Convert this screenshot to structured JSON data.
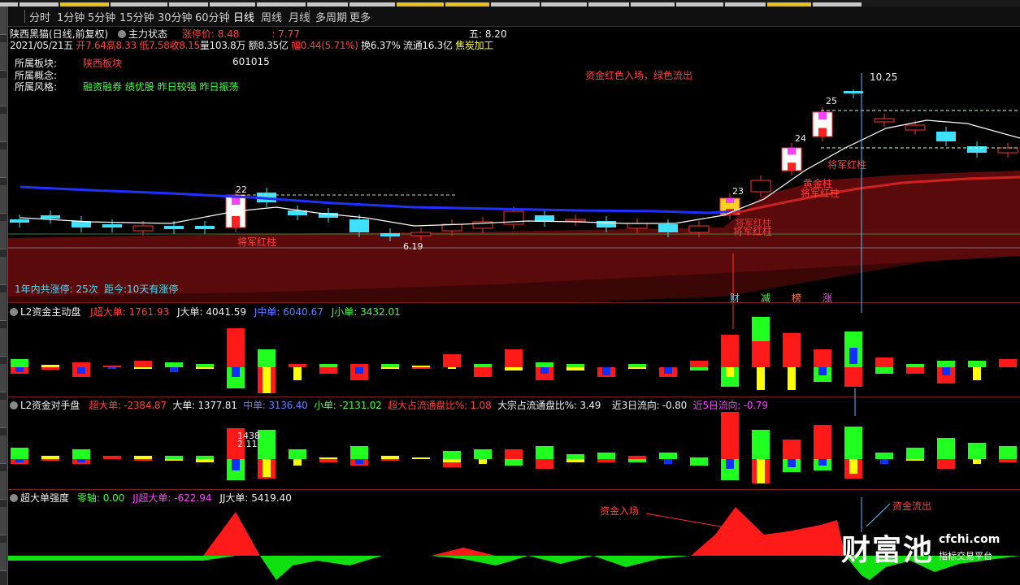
{
  "period_bar": {
    "items": [
      "分时",
      "1分钟",
      "5分钟",
      "15分钟",
      "30分钟",
      "60分钟",
      "日线",
      "周线",
      "月线",
      "多周期",
      "更多"
    ],
    "active": "日线"
  },
  "main": {
    "title": "陕西黑猫(日线,前复权)",
    "indicator": "主力状态",
    "limit_label": "涨停价: 8.48",
    "limit_extra": ": 7.77",
    "five_label": "五: 8.20",
    "date": "2021/05/21五",
    "open": "开7.64",
    "high": "高8.33",
    "low": "低7.58",
    "close": "收8.15",
    "volume": "量103.8万",
    "amount": "额8.35亿",
    "change": "幅0.44(5.71%)",
    "turnover": "换6.37%",
    "float": "流通16.3亿",
    "industry": "焦炭加工",
    "info": {
      "sector_label": "所属板块:",
      "sector_value": "陕西板块",
      "code": "601015",
      "concept_label": "所属概念:",
      "style_label": "所属风格:",
      "style_value": "融资融券 绩优股 昨日较强 昨日振荡"
    },
    "note_red_in": "资金红色入场，绿色流出",
    "price_high": "10.25",
    "price_low": "6.19",
    "limit_stats": "1年内共涨停: 25次",
    "days_since": "距今:10天有涨停",
    "counts": [
      "22",
      "23",
      "24",
      "25"
    ],
    "labels": [
      "将军红柱",
      "将军红柱",
      "将军红柱",
      "黄金柱",
      "将军红柱",
      "将军红柱"
    ],
    "tags": [
      "财",
      "减",
      "榜",
      "涨"
    ]
  },
  "panel1": {
    "name": "L2资金主动盘",
    "j_super": "J超大单: 1761.93",
    "j_big": "J大单: 4041.59",
    "j_mid": "J中单: 6040.67",
    "j_small": "J小单: 3432.01"
  },
  "panel2": {
    "name": "L2资金对手盘",
    "super": "超大单: -2384.87",
    "big": "大单: 1377.81",
    "mid": "中单: 3136.40",
    "small": "小单: -2131.02",
    "ratio": "超大占流通盘比%: 1.08",
    "big_ratio": "大宗占流通盘比%: 3.49",
    "flow3": "近3日流向: -0.80",
    "flow5": "近5日流向: -0.79",
    "n1": "1438",
    "n2": "2.11"
  },
  "panel3": {
    "name": "超大单强度",
    "zero": "零轴: 0.00",
    "jj_super": "JJ超大单: -622.94",
    "jj_big": "JJ大单: 5419.40",
    "in_label": "资金入场",
    "out_label": "资金流出"
  },
  "watermark": {
    "brand": "财富池",
    "domain": "cfchi.com",
    "slogan": "指标交易平台"
  },
  "colors": {
    "up": "#ff2020",
    "down": "#40e0ff",
    "green_bar": "#20ff20",
    "blue_bar": "#1030ff",
    "yellow_bar": "#ffff00",
    "band": "#5a0a0a"
  },
  "icons": [
    "panel-toggle-icon"
  ]
}
